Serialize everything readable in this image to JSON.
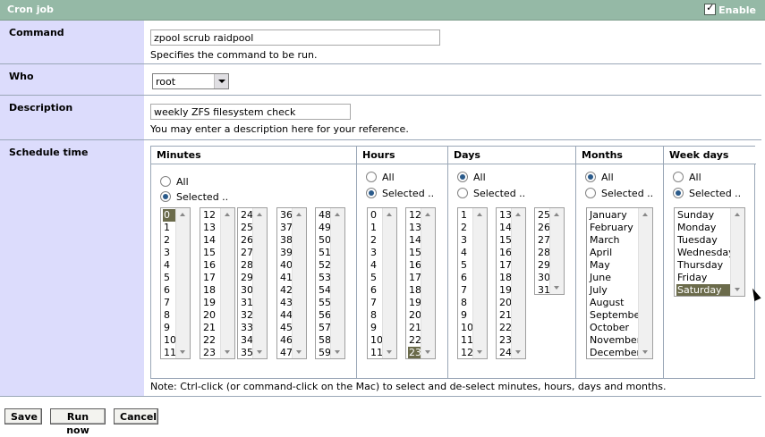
{
  "header": {
    "title": "Cron job",
    "enable_label": "Enable",
    "enabled": true
  },
  "command": {
    "label": "Command",
    "value": "zpool scrub raidpool",
    "help": "Specifies the command to be run."
  },
  "who": {
    "label": "Who",
    "value": "root"
  },
  "description": {
    "label": "Description",
    "value": "weekly ZFS filesystem check",
    "help": "You may enter a description here for your reference."
  },
  "schedule": {
    "label": "Schedule time",
    "option_all": "All",
    "option_selected": "Selected ..",
    "minutes": {
      "title": "Minutes",
      "mode": "selected",
      "selected": [
        "0"
      ],
      "columns": [
        [
          "0",
          "1",
          "2",
          "3",
          "4",
          "5",
          "6",
          "7",
          "8",
          "9",
          "10",
          "11"
        ],
        [
          "12",
          "13",
          "14",
          "15",
          "16",
          "17",
          "18",
          "19",
          "20",
          "21",
          "22",
          "23"
        ],
        [
          "24",
          "25",
          "26",
          "27",
          "28",
          "29",
          "30",
          "31",
          "32",
          "33",
          "34",
          "35"
        ],
        [
          "36",
          "37",
          "38",
          "39",
          "40",
          "41",
          "42",
          "43",
          "44",
          "45",
          "46",
          "47"
        ],
        [
          "48",
          "49",
          "50",
          "51",
          "52",
          "53",
          "54",
          "55",
          "56",
          "57",
          "58",
          "59"
        ]
      ]
    },
    "hours": {
      "title": "Hours",
      "mode": "selected",
      "selected": [
        "23"
      ],
      "columns": [
        [
          "0",
          "1",
          "2",
          "3",
          "4",
          "5",
          "6",
          "7",
          "8",
          "9",
          "10",
          "11"
        ],
        [
          "12",
          "13",
          "14",
          "15",
          "16",
          "17",
          "18",
          "19",
          "20",
          "21",
          "22",
          "23"
        ]
      ]
    },
    "days": {
      "title": "Days",
      "mode": "all",
      "selected": [],
      "columns": [
        [
          "1",
          "2",
          "3",
          "4",
          "5",
          "6",
          "7",
          "8",
          "9",
          "10",
          "11",
          "12"
        ],
        [
          "13",
          "14",
          "15",
          "16",
          "17",
          "18",
          "19",
          "20",
          "21",
          "22",
          "23",
          "24"
        ],
        [
          "25",
          "26",
          "27",
          "28",
          "29",
          "30",
          "31"
        ]
      ]
    },
    "months": {
      "title": "Months",
      "mode": "all",
      "selected": [],
      "columns": [
        [
          "January",
          "February",
          "March",
          "April",
          "May",
          "June",
          "July",
          "August",
          "September",
          "October",
          "November",
          "December"
        ]
      ]
    },
    "weekdays": {
      "title": "Week days",
      "mode": "selected",
      "selected": [
        "Saturday"
      ],
      "columns": [
        [
          "Sunday",
          "Monday",
          "Tuesday",
          "Wednesday",
          "Thursday",
          "Friday",
          "Saturday"
        ]
      ]
    },
    "note": "Note: Ctrl-click (or command-click on the Mac) to select and de-select minutes, hours, days and months."
  },
  "buttons": {
    "save": "Save",
    "run_now": "Run now",
    "cancel": "Cancel"
  }
}
